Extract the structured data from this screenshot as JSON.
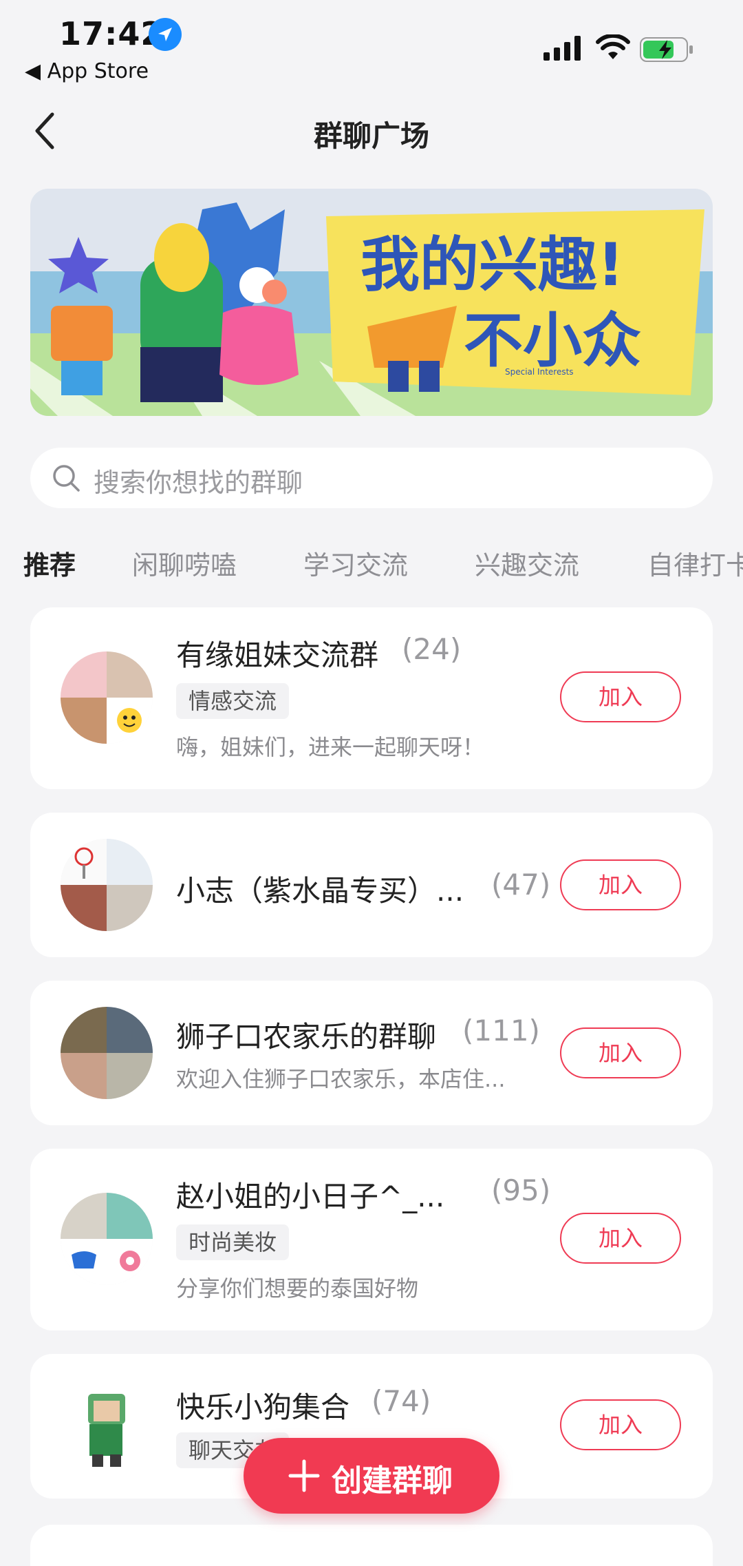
{
  "status_bar": {
    "time": "17:42",
    "back_app": "◀ App Store",
    "battery": "charging"
  },
  "nav": {
    "title": "群聊广场"
  },
  "banner": {
    "line1": "我的兴趣!",
    "line2": "不小众",
    "subtitle": "Special Interests"
  },
  "search": {
    "placeholder": "搜索你想找的群聊"
  },
  "tabs": [
    {
      "label": "推荐",
      "active": true
    },
    {
      "label": "闲聊唠嗑",
      "active": false
    },
    {
      "label": "学习交流",
      "active": false
    },
    {
      "label": "兴趣交流",
      "active": false
    },
    {
      "label": "自律打卡",
      "active": false
    }
  ],
  "groups": [
    {
      "name": "有缘姐妹交流群",
      "count": "(24)",
      "tag": "情感交流",
      "desc": "嗨，姐妹们，进来一起聊天呀！",
      "join": "加入"
    },
    {
      "name": "小志（紫水晶专买）...",
      "count": "(47)",
      "tag": "",
      "desc": "",
      "join": "加入"
    },
    {
      "name": "狮子口农家乐的群聊",
      "count": "(111)",
      "tag": "",
      "desc": "欢迎入住狮子口农家乐，本店住...",
      "join": "加入"
    },
    {
      "name": "赵小姐的小日子^_...",
      "count": "(95)",
      "tag": "时尚美妆",
      "desc": "分享你们想要的泰国好物",
      "join": "加入"
    },
    {
      "name": "快乐小狗集合",
      "count": "(74)",
      "tag": "聊天交友",
      "desc": "",
      "join": "加入"
    }
  ],
  "fab": {
    "label": "创建群聊"
  },
  "colors": {
    "accent": "#ef3b54",
    "background": "#f4f4f6"
  }
}
